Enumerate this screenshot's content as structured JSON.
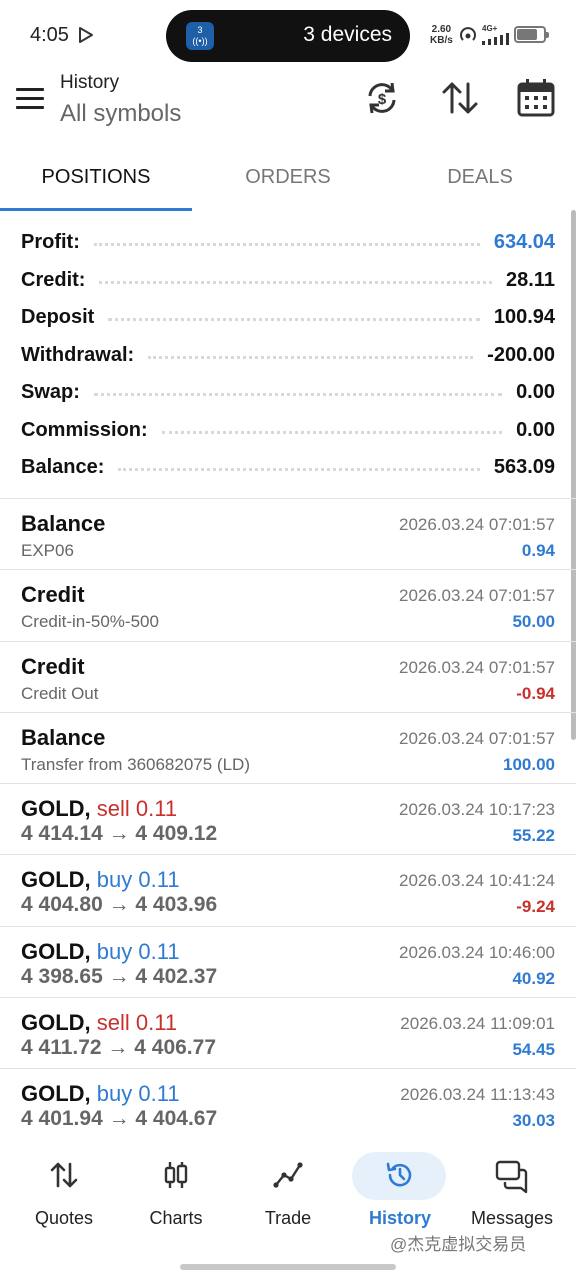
{
  "status_bar": {
    "time": "4:05",
    "island_app_badge": "3",
    "island_text": "3 devices",
    "speed_value": "2.60",
    "speed_unit": "KB/s",
    "network": "4G+",
    "battery_percent": 80
  },
  "header": {
    "title": "History",
    "subtitle": "All symbols"
  },
  "tabs": [
    {
      "label": "POSITIONS",
      "active": true
    },
    {
      "label": "ORDERS",
      "active": false
    },
    {
      "label": "DEALS",
      "active": false
    }
  ],
  "summary": [
    {
      "label": "Profit:",
      "value": "634.04"
    },
    {
      "label": "Credit:",
      "value": "28.11"
    },
    {
      "label": "Deposit",
      "value": "100.94"
    },
    {
      "label": "Withdrawal:",
      "value": "-200.00"
    },
    {
      "label": "Swap:",
      "value": "0.00"
    },
    {
      "label": "Commission:",
      "value": "0.00"
    },
    {
      "label": "Balance:",
      "value": "563.09"
    }
  ],
  "items": [
    {
      "symbol": "Balance",
      "side": "",
      "subtitle": "EXP06",
      "datetime": "2026.03.24 07:01:57",
      "amount": "0.94"
    },
    {
      "symbol": "Credit",
      "side": "",
      "subtitle": "Credit-in-50%-500",
      "datetime": "2026.03.24 07:01:57",
      "amount": "50.00"
    },
    {
      "symbol": "Credit",
      "side": "",
      "subtitle": "Credit Out",
      "datetime": "2026.03.24 07:01:57",
      "amount": "-0.94"
    },
    {
      "symbol": "Balance",
      "side": "",
      "subtitle": "Transfer from 360682075 (LD)",
      "datetime": "2026.03.24 07:01:57",
      "amount": "100.00"
    },
    {
      "symbol": "GOLD,",
      "side": "sell 0.11",
      "subtitle": "4 414.14 → 4 409.12",
      "datetime": "2026.03.24 10:17:23",
      "amount": "55.22"
    },
    {
      "symbol": "GOLD,",
      "side": "buy 0.11",
      "subtitle": "4 404.80 → 4 403.96",
      "datetime": "2026.03.24 10:41:24",
      "amount": "-9.24"
    },
    {
      "symbol": "GOLD,",
      "side": "buy 0.11",
      "subtitle": "4 398.65 → 4 402.37",
      "datetime": "2026.03.24 10:46:00",
      "amount": "40.92"
    },
    {
      "symbol": "GOLD,",
      "side": "sell 0.11",
      "subtitle": "4 411.72 → 4 406.77",
      "datetime": "2026.03.24 11:09:01",
      "amount": "54.45"
    },
    {
      "symbol": "GOLD,",
      "side": "buy 0.11",
      "subtitle": "4 401.94 → 4 404.67",
      "datetime": "2026.03.24 11:13:43",
      "amount": "30.03"
    }
  ],
  "bottom_nav": [
    {
      "label": "Quotes",
      "icon": "quotes-icon"
    },
    {
      "label": "Charts",
      "icon": "charts-icon"
    },
    {
      "label": "Trade",
      "icon": "trade-icon"
    },
    {
      "label": "History",
      "icon": "history-icon"
    },
    {
      "label": "Messages",
      "icon": "messages-icon"
    }
  ],
  "active_nav": "History",
  "watermark": "@杰克虚拟交易员",
  "colors": {
    "accent_blue": "#2f7bd1",
    "loss_red": "#c9302c"
  }
}
